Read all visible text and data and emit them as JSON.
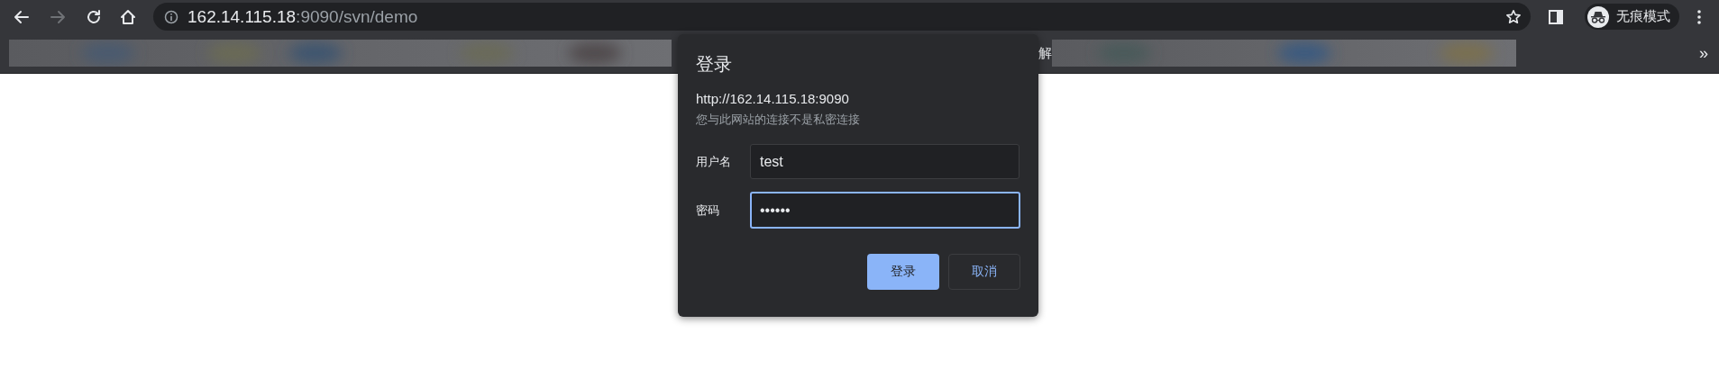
{
  "toolbar": {
    "back_enabled": true,
    "forward_enabled": false,
    "address": {
      "host": "162.14.115.18",
      "rest": ":9090/svn/demo"
    },
    "profile_label": "无痕模式"
  },
  "bookmarks_bar": {
    "fragment": "解",
    "overflow": "»"
  },
  "dialog": {
    "title": "登录",
    "origin": "http://162.14.115.18:9090",
    "warning": "您与此网站的连接不是私密连接",
    "fields": [
      {
        "label": "用户名",
        "value": "test",
        "focused": false
      },
      {
        "label": "密码",
        "value": "••••••",
        "focused": true
      }
    ],
    "buttons": [
      {
        "label": "登录",
        "kind": "primary"
      },
      {
        "label": "取消",
        "kind": "secondary"
      }
    ]
  }
}
